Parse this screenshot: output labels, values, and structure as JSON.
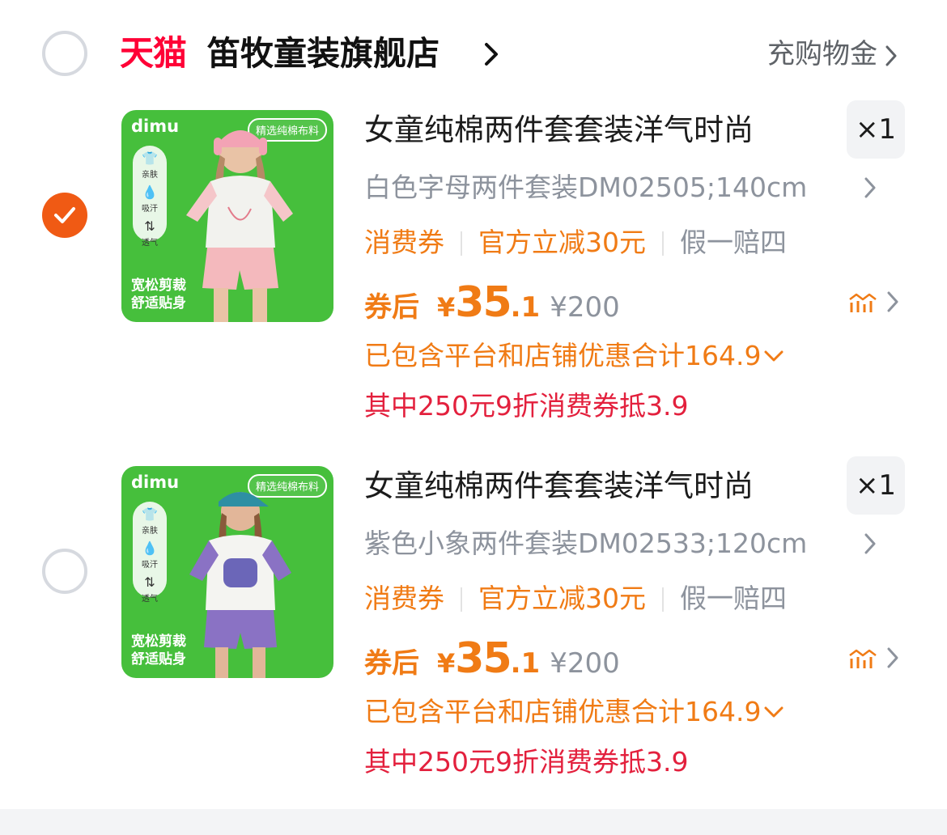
{
  "shop": {
    "platform_logo": "天猫",
    "name": "笛牧童装旗舰店",
    "topup_label": "充购物金"
  },
  "items": [
    {
      "checked": true,
      "image": {
        "brand": "dimu",
        "badge": "精选纯棉布料",
        "features": [
          "亲肤",
          "吸汗",
          "透气"
        ],
        "slogan_1": "宽松剪裁",
        "slogan_2": "舒适贴身"
      },
      "title": "女童纯棉两件套套装洋气时尚",
      "quantity": "×1",
      "sku": "白色字母两件套装DM02505;140cm",
      "tags": [
        "消费券",
        "官方立减30元",
        "假一赔四"
      ],
      "price_prefix": "券后",
      "currency": "¥",
      "price_int": "35",
      "price_dec": ".1",
      "original_price": "¥200",
      "discount_summary": "已包含平台和店铺优惠合计164.9",
      "coupon_note": "其中250元9折消费券抵3.9"
    },
    {
      "checked": false,
      "image": {
        "brand": "dimu",
        "badge": "精选纯棉布料",
        "features": [
          "亲肤",
          "吸汗",
          "透气"
        ],
        "slogan_1": "宽松剪裁",
        "slogan_2": "舒适贴身"
      },
      "title": "女童纯棉两件套套装洋气时尚",
      "quantity": "×1",
      "sku": "紫色小象两件套装DM02533;120cm",
      "tags": [
        "消费券",
        "官方立减30元",
        "假一赔四"
      ],
      "price_prefix": "券后",
      "currency": "¥",
      "price_int": "35",
      "price_dec": ".1",
      "original_price": "¥200",
      "discount_summary": "已包含平台和店铺优惠合计164.9",
      "coupon_note": "其中250元9折消费券抵3.9"
    }
  ],
  "colors": {
    "accent": "#f05a14",
    "price": "#f07b15",
    "coupon": "#e3203d",
    "tmall": "#ff0036",
    "thumb_bg": "#46bf3c"
  }
}
